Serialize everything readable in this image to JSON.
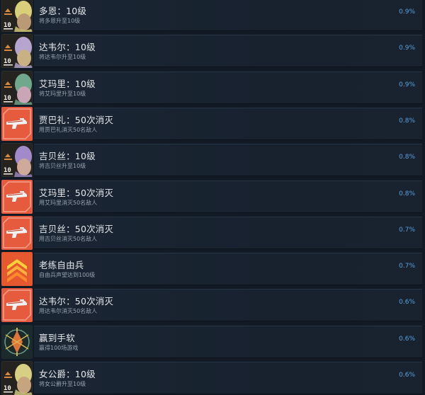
{
  "achievements": [
    {
      "title": "多恩：10级",
      "desc": "将多恩升至10级",
      "percent": "0.9%",
      "icon": "level-up-character-icon",
      "colors": {
        "bg": "#24231f",
        "hair": "#d9cf7a",
        "face": "#b99a74",
        "accent": "#d98840"
      }
    },
    {
      "title": "达韦尔：10级",
      "desc": "将达韦尔升至10级",
      "percent": "0.9%",
      "icon": "level-up-character-icon",
      "colors": {
        "bg": "#24231f",
        "hair": "#b6a6cf",
        "face": "#c8b182",
        "accent": "#d98840"
      }
    },
    {
      "title": "艾玛里：10级",
      "desc": "将艾玛里升至10级",
      "percent": "0.9%",
      "icon": "level-up-character-icon",
      "colors": {
        "bg": "#24231f",
        "hair": "#6fa88c",
        "face": "#c9a5b6",
        "accent": "#d98840"
      }
    },
    {
      "title": "贾巴礼：50次消灭",
      "desc": "用贾巴礼消灭50名敌人",
      "percent": "0.8%",
      "icon": "weapon-kills-icon",
      "colors": {
        "bg": "#e65a3e",
        "hair": "#f2f2f2",
        "face": "#f6e0d8",
        "accent": "#b73a25"
      }
    },
    {
      "title": "吉贝丝：10级",
      "desc": "将吉贝丝升至10级",
      "percent": "0.8%",
      "icon": "level-up-character-icon",
      "colors": {
        "bg": "#24231f",
        "hair": "#a08ac9",
        "face": "#cfa999",
        "accent": "#d98840"
      }
    },
    {
      "title": "艾玛里：50次消灭",
      "desc": "用艾玛里消灭50名敌人",
      "percent": "0.8%",
      "icon": "weapon-kills-icon",
      "colors": {
        "bg": "#e65a3e",
        "hair": "#f2f2f2",
        "face": "#f6e0d8",
        "accent": "#b73a25"
      }
    },
    {
      "title": "吉贝丝：50次消灭",
      "desc": "用吉贝丝消灭50名敌人",
      "percent": "0.7%",
      "icon": "weapon-kills-icon",
      "colors": {
        "bg": "#e65a3e",
        "hair": "#f2f2f2",
        "face": "#f6e0d8",
        "accent": "#b73a25"
      }
    },
    {
      "title": "老练自由兵",
      "desc": "自由兵声望达到100级",
      "percent": "0.7%",
      "icon": "rank-chevrons-icon",
      "colors": {
        "bg": "#e6582d",
        "hair": "#ffb13b",
        "face": "#ffd23a",
        "accent": "#c43d1e"
      }
    },
    {
      "title": "达韦尔：50次消灭",
      "desc": "用达韦尔消灭50名敌人",
      "percent": "0.6%",
      "icon": "weapon-kills-icon",
      "colors": {
        "bg": "#e65a3e",
        "hair": "#f2f2f2",
        "face": "#f6e0d8",
        "accent": "#b73a25"
      }
    },
    {
      "title": "赢到手软",
      "desc": "赢得100场游戏",
      "percent": "0.6%",
      "icon": "trophy-emblem-icon",
      "colors": {
        "bg": "#1b2a2a",
        "hair": "#d8b24a",
        "face": "#e0733a",
        "accent": "#6c9a8a"
      }
    },
    {
      "title": "女公爵：10级",
      "desc": "将女公爵升至10级",
      "percent": "0.6%",
      "icon": "level-up-character-icon",
      "colors": {
        "bg": "#24231f",
        "hair": "#d7cf84",
        "face": "#c6a57e",
        "accent": "#d98840"
      }
    }
  ]
}
